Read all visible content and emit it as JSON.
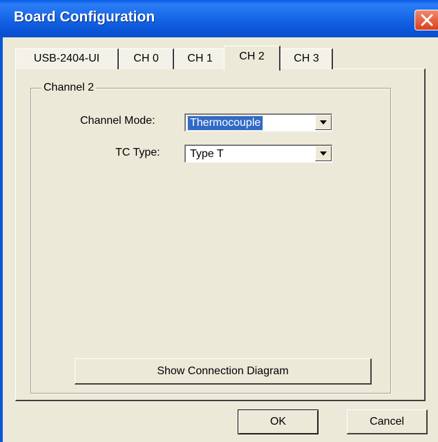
{
  "window": {
    "title": "Board Configuration"
  },
  "tabs": [
    {
      "label": "USB-2404-UI"
    },
    {
      "label": "CH 0"
    },
    {
      "label": "CH 1"
    },
    {
      "label": "CH 2",
      "active": true
    },
    {
      "label": "CH 3"
    }
  ],
  "group": {
    "title": "Channel 2",
    "channel_mode": {
      "label": "Channel Mode:",
      "value": "Thermocouple"
    },
    "tc_type": {
      "label": "TC Type:",
      "value": "Type T"
    },
    "diagram_button": "Show Connection Diagram"
  },
  "footer": {
    "ok": "OK",
    "cancel": "Cancel"
  },
  "colors": {
    "titlebar": "#0b55d8",
    "face": "#ece9d8",
    "selection": "#316ac5",
    "close": "#d9401c"
  }
}
